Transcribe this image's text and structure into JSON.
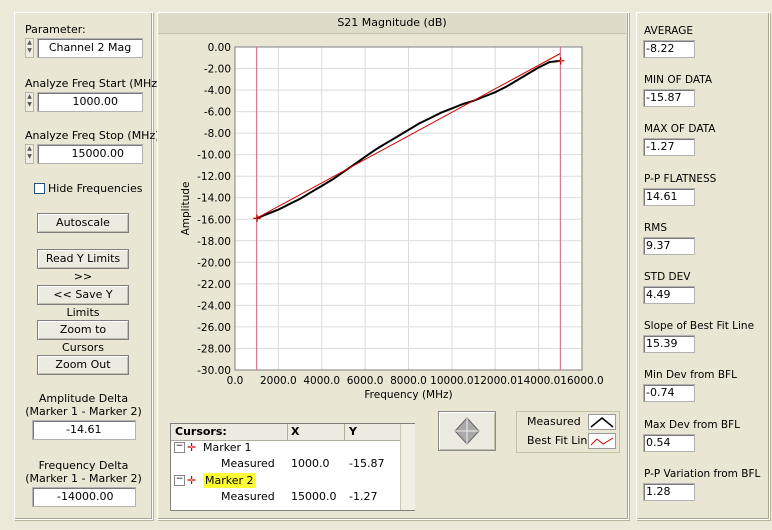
{
  "left_panel": {
    "parameter_label": "Parameter:",
    "parameter_value": "Channel 2 Mag",
    "start_label": "Analyze Freq Start (MHz)",
    "start_value": "1000.00",
    "stop_label": "Analyze Freq Stop (MHz)",
    "stop_value": "15000.00",
    "hide_freq_label": "Hide Frequencies",
    "hide_freq_checked": false,
    "buttons": {
      "autoscale": "Autoscale",
      "read_y": "Read Y Limits >>",
      "save_y": "<< Save Y Limits",
      "zoom_cursors": "Zoom to Cursors",
      "zoom_out": "Zoom Out"
    },
    "amp_delta_label_1": "Amplitude Delta",
    "amp_delta_label_2": "(Marker 1 - Marker 2)",
    "amp_delta_value": "-14.61",
    "freq_delta_label_1": "Frequency Delta",
    "freq_delta_label_2": "(Marker 1 - Marker 2)",
    "freq_delta_value": "-14000.00"
  },
  "chart_data": {
    "type": "line",
    "title": "S21 Magnitude (dB)",
    "xlabel": "Frequency (MHz)",
    "ylabel": "Amplitude",
    "xlim": [
      0,
      16000
    ],
    "ylim": [
      -30,
      0
    ],
    "x_ticks": [
      "0.0",
      "2000.0",
      "4000.0",
      "6000.0",
      "8000.0",
      "10000.0",
      "12000.0",
      "14000.0",
      "16000.0"
    ],
    "y_ticks": [
      "0.00",
      "-2.00",
      "-4.00",
      "-6.00",
      "-8.00",
      "-10.00",
      "-12.00",
      "-14.00",
      "-16.00",
      "-18.00",
      "-20.00",
      "-22.00",
      "-24.00",
      "-26.00",
      "-28.00",
      "-30.00"
    ],
    "grid": true,
    "series": [
      {
        "name": "Measured",
        "color": "#000000",
        "x": [
          1000,
          1500,
          2000,
          2500,
          3000,
          3500,
          4000,
          4500,
          5000,
          5500,
          6000,
          6500,
          7000,
          7500,
          8000,
          8500,
          9000,
          9500,
          10000,
          10500,
          11000,
          11500,
          12000,
          12500,
          13000,
          13500,
          14000,
          14500,
          15000
        ],
        "y": [
          -15.9,
          -15.5,
          -15.1,
          -14.6,
          -14.1,
          -13.5,
          -12.9,
          -12.3,
          -11.6,
          -10.9,
          -10.2,
          -9.5,
          -8.9,
          -8.3,
          -7.7,
          -7.1,
          -6.6,
          -6.1,
          -5.7,
          -5.3,
          -5.0,
          -4.6,
          -4.2,
          -3.7,
          -3.1,
          -2.5,
          -1.9,
          -1.4,
          -1.27
        ]
      },
      {
        "name": "Best Fit Line",
        "color": "#d40000",
        "x": [
          1000,
          15000
        ],
        "y": [
          -15.9,
          -0.6
        ]
      }
    ],
    "cursors_x": [
      1000,
      15000
    ],
    "cursor_color": "#d06070"
  },
  "cursors_table": {
    "headers": [
      "Cursors:",
      "X",
      "Y"
    ],
    "marker1_name": "Marker 1",
    "marker1_sub": "Measured",
    "marker1_x": "1000.0",
    "marker1_y": "-15.87",
    "marker2_name": "Marker 2",
    "marker2_sub": "Measured",
    "marker2_x": "15000.0",
    "marker2_y": "-1.27"
  },
  "legend": {
    "measured": "Measured",
    "best_fit": "Best Fit Line"
  },
  "stats": [
    {
      "label": "AVERAGE",
      "value": "-8.22"
    },
    {
      "label": "MIN OF DATA",
      "value": "-15.87"
    },
    {
      "label": "MAX OF DATA",
      "value": "-1.27"
    },
    {
      "label": "P-P FLATNESS",
      "value": "14.61"
    },
    {
      "label": "RMS",
      "value": "9.37"
    },
    {
      "label": "STD DEV",
      "value": "4.49"
    },
    {
      "label": "Slope of Best Fit Line",
      "value": "15.39"
    },
    {
      "label": "Min Dev from BFL",
      "value": "-0.74"
    },
    {
      "label": "Max Dev from BFL",
      "value": "0.54"
    },
    {
      "label": "P-P Variation from BFL",
      "value": "1.28"
    }
  ],
  "colors": {
    "marker_highlight": "#ffff33",
    "background": "#ece9d8"
  }
}
